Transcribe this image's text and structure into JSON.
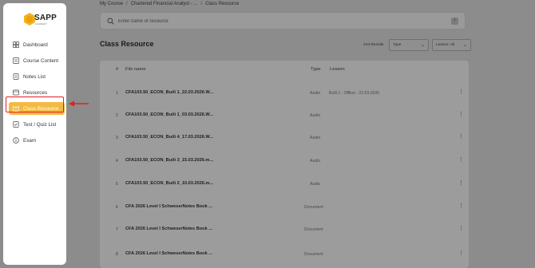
{
  "logo": {
    "text": "SAPP",
    "sub": "ACADEMY"
  },
  "sidebar": {
    "items": [
      {
        "label": "Dashboard",
        "icon": "grid-icon"
      },
      {
        "label": "Course Content",
        "icon": "course-icon"
      },
      {
        "label": "Notes List",
        "icon": "notes-icon"
      },
      {
        "label": "Resources",
        "icon": "resources-icon"
      },
      {
        "label": "Class Resource",
        "icon": "book-icon",
        "active": true
      },
      {
        "label": "Test / Quiz List",
        "icon": "checklist-icon"
      },
      {
        "label": "Exam",
        "icon": "info-icon"
      }
    ]
  },
  "breadcrumb": [
    "My Course",
    "Chartered Financial Analyst - ...",
    "Class Resource"
  ],
  "search": {
    "placeholder": "Enter name of resource",
    "button": "/"
  },
  "page": {
    "title": "Class Resource",
    "results": "243 Results"
  },
  "filters": {
    "type": "Type",
    "lesson": "Lesson: All"
  },
  "table": {
    "headers": {
      "index": "#",
      "file": "File name",
      "type": "Type",
      "lesson": "Lesson"
    },
    "rows": [
      {
        "index": "1",
        "file": "CFA103.50_ECON_Buổi 1_22.03.2026.W...",
        "type": "Audio",
        "lesson": "Buổi 1 - Offline - 22-03-2026"
      },
      {
        "index": "2",
        "file": "CFA103.50_ECON_Buổi 1_03.03.2026.W...",
        "type": "Audio",
        "lesson": ""
      },
      {
        "index": "3",
        "file": "CFA103.50_ECON_Buổi 4_17.03.2026.W...",
        "type": "Audio",
        "lesson": ""
      },
      {
        "index": "4",
        "file": "CFA103.50_ECON_Buổi 3_15.03.2026.m...",
        "type": "Audio",
        "lesson": ""
      },
      {
        "index": "5",
        "file": "CFA103.50_ECON_Buổi 2_10.03.2026.m...",
        "type": "Audio",
        "lesson": ""
      },
      {
        "index": "6",
        "file": "CFA 2026 Level I SchweserNotes Book ...",
        "type": "Document",
        "lesson": ""
      },
      {
        "index": "7",
        "file": "CFA 2026 Level I SchweserNotes Book ...",
        "type": "Document",
        "lesson": ""
      },
      {
        "index": "8",
        "file": "CFA 2026 Level I SchweserNotes Book ...",
        "type": "Document",
        "lesson": ""
      }
    ]
  },
  "colors": {
    "accent": "#f4b942",
    "highlight": "#e02020",
    "overlay": "#8c8c8c"
  }
}
